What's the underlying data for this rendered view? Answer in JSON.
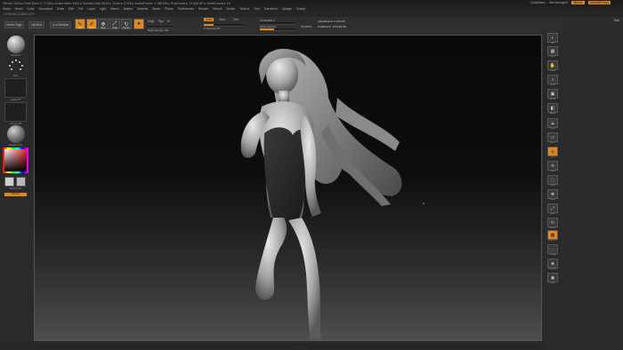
{
  "titlebar": {
    "title": "ZBrush 2019  ▸  Free Mem 17.0 GB  ▸  Active Mem 3431  ▸  Scratch Disk 9818  ▸  Timer ▸ 0.015  ▸  ActivePoints: 2.165 Mil  ▸  PolyCount ▸ 79.434 KP  ▸  MeshCount ▸ 18",
    "right_items": [
      "QuickSave",
      "See-through  0",
      "Menus",
      "DefaultZScript"
    ]
  },
  "menu": [
    "Alpha",
    "Brush",
    "Color",
    "Document",
    "Draw",
    "Edit",
    "File",
    "Layer",
    "Light",
    "Macro",
    "Marker",
    "Material",
    "Movie",
    "Picker",
    "Preferences",
    "Render",
    "Stencil",
    "Stroke",
    "Texture",
    "Tool",
    "Transform",
    "Zplugin",
    "Zscript"
  ],
  "subbar": "0.1Sketch 12.2Bel 100%",
  "toolbar": {
    "home_page": "Home Page",
    "lightbox": "LightBox",
    "live_boolean": "Live Boolean",
    "edit": "Edit",
    "draw": "Draw",
    "move": "Move",
    "scale": "Scale",
    "rotate": "Rotate",
    "mrgb": "Mrgb",
    "rgb": "Rgb",
    "m": "M",
    "zadd": "Zadd",
    "zsub": "Zsub",
    "zcut": "Zcut",
    "rgb_intensity": "Rgb Intensity 100",
    "z_intensity": "Z Intensity 25",
    "focal_shift": "Focal Shift 0",
    "draw_size": "Draw Size 64",
    "dynamic": "Dynamic",
    "active_points": "ActivePoints: 2,165 Mil",
    "total_points": "TotalPoints: 179.624 Mil"
  },
  "left_shelf": {
    "items": [
      "Standard",
      "Dots",
      "Alpha Off",
      "Texture Off",
      "MatCap Gray"
    ],
    "gradient": "Gradient",
    "switch_color": "SwitchColor",
    "alternate": "Alternate"
  },
  "right_shelf": {
    "labels": [
      "BPR",
      "SPix 3",
      "Scroll",
      "Zoom",
      "Actual",
      "AAHalf",
      "Persp",
      "Floor",
      "Local",
      "Gizmo",
      "Frame",
      "Move",
      "Scale",
      "Rotate",
      "Line Fill",
      "Transp",
      "Dynamic",
      "Solo"
    ],
    "tool_label": "Tool"
  },
  "bottombar": "· · · · · · · ·",
  "colors": {
    "accent": "#e08a1e",
    "panel": "#2a2a2a",
    "viewport_top": "#0a0a0a",
    "viewport_bottom": "#4e4e4e"
  }
}
